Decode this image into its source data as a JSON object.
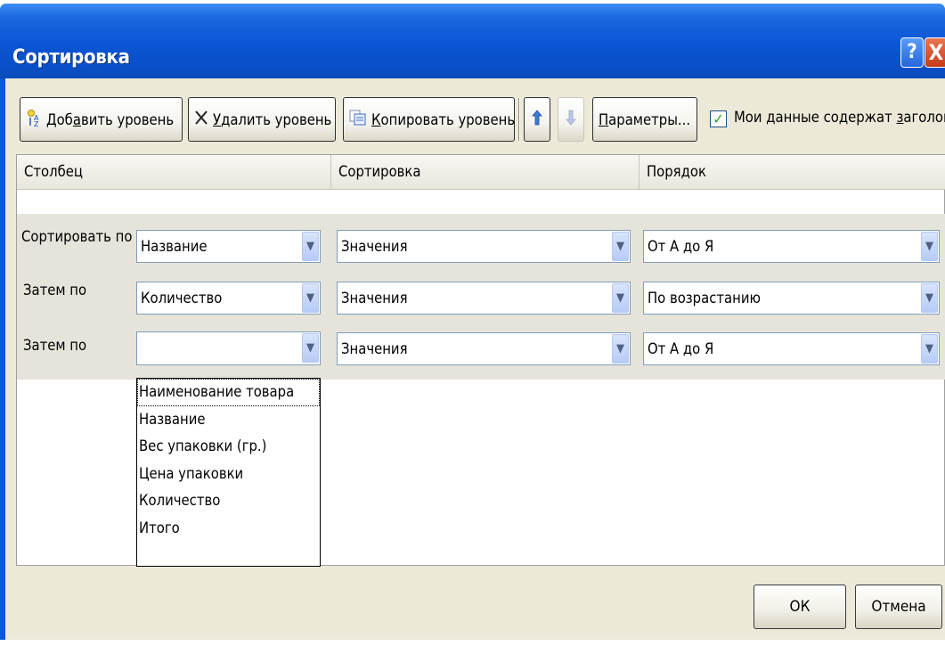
{
  "window": {
    "title": "Сортировка",
    "help_label": "?",
    "close_label": "X"
  },
  "toolbar": {
    "add_level": {
      "pre": "Доб",
      "accel": "а",
      "post": "вить уровень"
    },
    "delete_level": {
      "accel": "У",
      "post": "далить уровень"
    },
    "copy_level": {
      "accel": "К",
      "post": "опировать уровень"
    },
    "options": {
      "accel": "П",
      "post": "араметры..."
    },
    "move_up_icon": "arrow-up",
    "move_down_icon": "arrow-down",
    "headers_checkbox": {
      "checked": true,
      "pre": "Мои данные содержат ",
      "accel": "з",
      "post": "аголовки"
    }
  },
  "grid": {
    "headers": {
      "column": "Столбец",
      "sort_on": "Сортировка",
      "order": "Порядок"
    },
    "rows": [
      {
        "label": "Сортировать по",
        "column": "Название",
        "sort_on": "Значения",
        "order": "От А до Я"
      },
      {
        "label": "Затем по",
        "column": "Количество",
        "sort_on": "Значения",
        "order": "По возрастанию"
      },
      {
        "label": "Затем по",
        "column": "",
        "sort_on": "Значения",
        "order": "От А до Я"
      }
    ]
  },
  "dropdown": {
    "items": [
      "Наименование товара",
      "Название",
      "Вес упаковки (гр.)",
      "Цена упаковки",
      "Количество",
      "Итого"
    ]
  },
  "footer": {
    "ok_label": "ОК",
    "cancel_label": "Отмена"
  },
  "colors": {
    "titlebar": "#0a58d6",
    "dialog_bg": "#ece9d8",
    "row_bg": "#e6e4da",
    "combo_arrow": "#b6cbf6"
  }
}
